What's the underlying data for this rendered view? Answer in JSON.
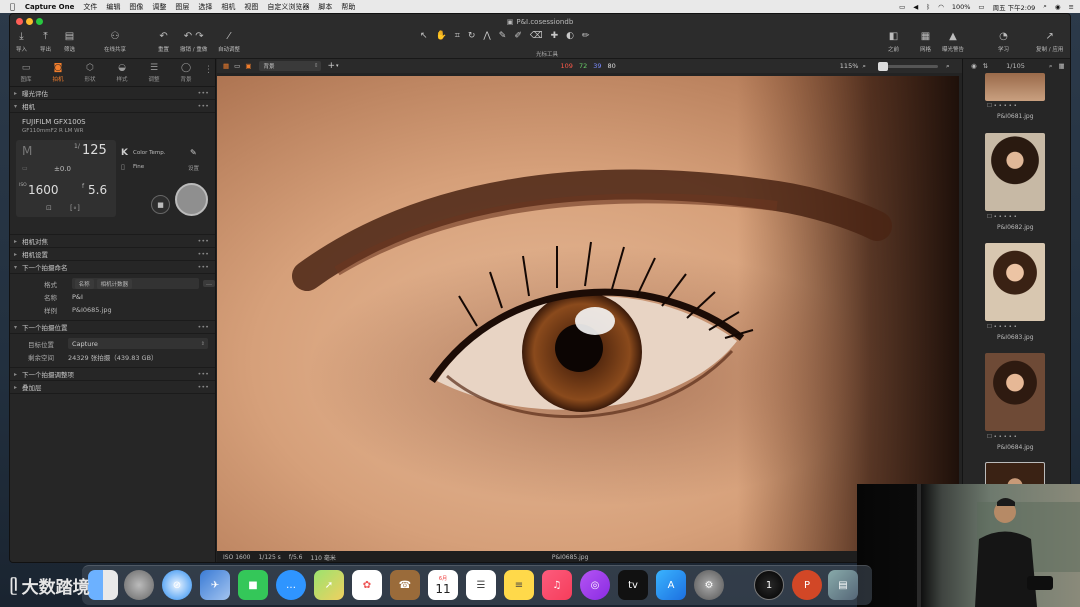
{
  "menubar": {
    "apple": "",
    "app": "Capture One",
    "items": [
      "文件",
      "编辑",
      "图像",
      "调整",
      "图层",
      "选择",
      "相机",
      "视图",
      "自定义浏览器",
      "脚本",
      "帮助"
    ],
    "battery": "100%",
    "clock": "周五 下午2:09"
  },
  "window": {
    "title": "P&I.cosessiondb"
  },
  "toolbar": {
    "import": "导入",
    "export": "导出",
    "filter": "筛选",
    "share": "在线共享",
    "reset": "重置",
    "undo_redo": "撤销 / 重做",
    "auto_adjust": "自动调整",
    "cursor_tools": "光标工具",
    "before": "之前",
    "grid": "网格",
    "exposure_warning": "曝光警告",
    "learn": "学习",
    "copy_apply": "复制 / 应用"
  },
  "left_tabs": [
    "图库",
    "拍机",
    "形状",
    "样式",
    "调整",
    "背景"
  ],
  "left_panel": {
    "sec_exposure_eval": "曝光评估",
    "sec_camera": "相机",
    "camera_model": "FUJIFILM GFX100S",
    "camera_lens": "GF110mmF2 R LM WR",
    "shutter": "125",
    "shutter_frac": "1/",
    "ev": "±0.0",
    "iso": "1600",
    "iso_prefix": "ISO",
    "aperture": "5.6",
    "aperture_prefix": "f",
    "color_temp_label": "Color Temp.",
    "color_temp_k": "K",
    "fine": "Fine",
    "settings": "设置",
    "sec_focus": "相机对焦",
    "sec_camera_settings": "相机设置",
    "sec_next_naming": "下一个拍摄命名",
    "format_label": "格式",
    "format_chips": [
      "名称",
      "相机计数器"
    ],
    "name_label": "名称",
    "name_value": "P&I",
    "sample_label": "样例",
    "sample_value": "P&I0685.jpg",
    "sec_next_location": "下一个拍摄位置",
    "target_label": "目标位置",
    "target_value": "Capture",
    "space_label": "剩余空间",
    "space_value": "24329 张拍摄（439.83 GB）",
    "sec_next_adjust": "下一个拍摄调整项",
    "sec_overlay": "叠加层"
  },
  "viewer": {
    "styles_select": "背景",
    "rgb": [
      "109",
      "72",
      "39",
      "80"
    ],
    "zoom": "115%",
    "exif_iso": "ISO 1600",
    "exif_shutter": "1/125 s",
    "exif_aperture": "f/5.6",
    "exif_focal": "110 毫米",
    "filename": "P&I0685.jpg"
  },
  "filmstrip": {
    "counter": "1/105",
    "items": [
      {
        "name": "P&I0681.jpg"
      },
      {
        "name": "P&I0682.jpg"
      },
      {
        "name": "P&I0683.jpg"
      },
      {
        "name": "P&I0684.jpg"
      }
    ]
  },
  "dock": {
    "calendar_month": "6月",
    "calendar_day": "11"
  },
  "watermark": "大数踏境"
}
